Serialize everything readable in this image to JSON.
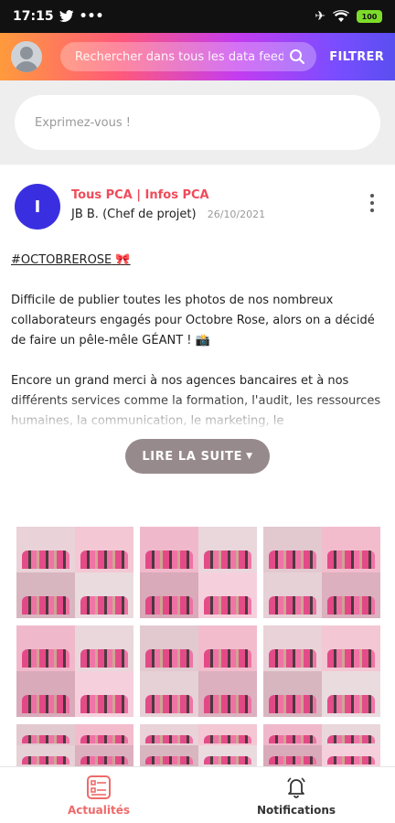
{
  "status_bar": {
    "time": "17:15",
    "battery": "100"
  },
  "top_bar": {
    "search_placeholder": "Rechercher dans tous les data feed",
    "filter_label": "FILTRER",
    "gradient_colors": [
      "#ff9a3c",
      "#ff5a7a",
      "#c43cf0",
      "#7a4dff",
      "#5a4ff0"
    ]
  },
  "composer": {
    "placeholder": "Exprimez-vous !"
  },
  "post": {
    "avatar_initial": "I",
    "group": "Tous PCA | Infos PCA",
    "author": "JB B. (Chef de projet)",
    "date": "26/10/2021",
    "hashtag": "#OCTOBREROSE",
    "hashtag_emoji": "🎀",
    "paragraph_1": "Difficile de publier toutes les photos de nos nombreux collaborateurs engagés pour Octobre Rose, alors on a décidé de faire un pêle-mêle GÉANT ! 📸",
    "paragraph_2": "Encore un grand merci à nos agences bancaires et à nos différents services comme la formation, l'audit, les ressources humaines, la communication, le marketing, le développement… en Provence Côte d'Azur, de contribuer à ce",
    "read_more_label": "LIRE LA SUITE",
    "accent_color": "#ee4c5a"
  },
  "gallery": {
    "photo_count": 9
  },
  "bottom_nav": {
    "items": [
      {
        "label": "Actualités",
        "icon": "newsfeed-icon",
        "active": true
      },
      {
        "label": "Notifications",
        "icon": "bell-icon",
        "active": false
      }
    ]
  }
}
